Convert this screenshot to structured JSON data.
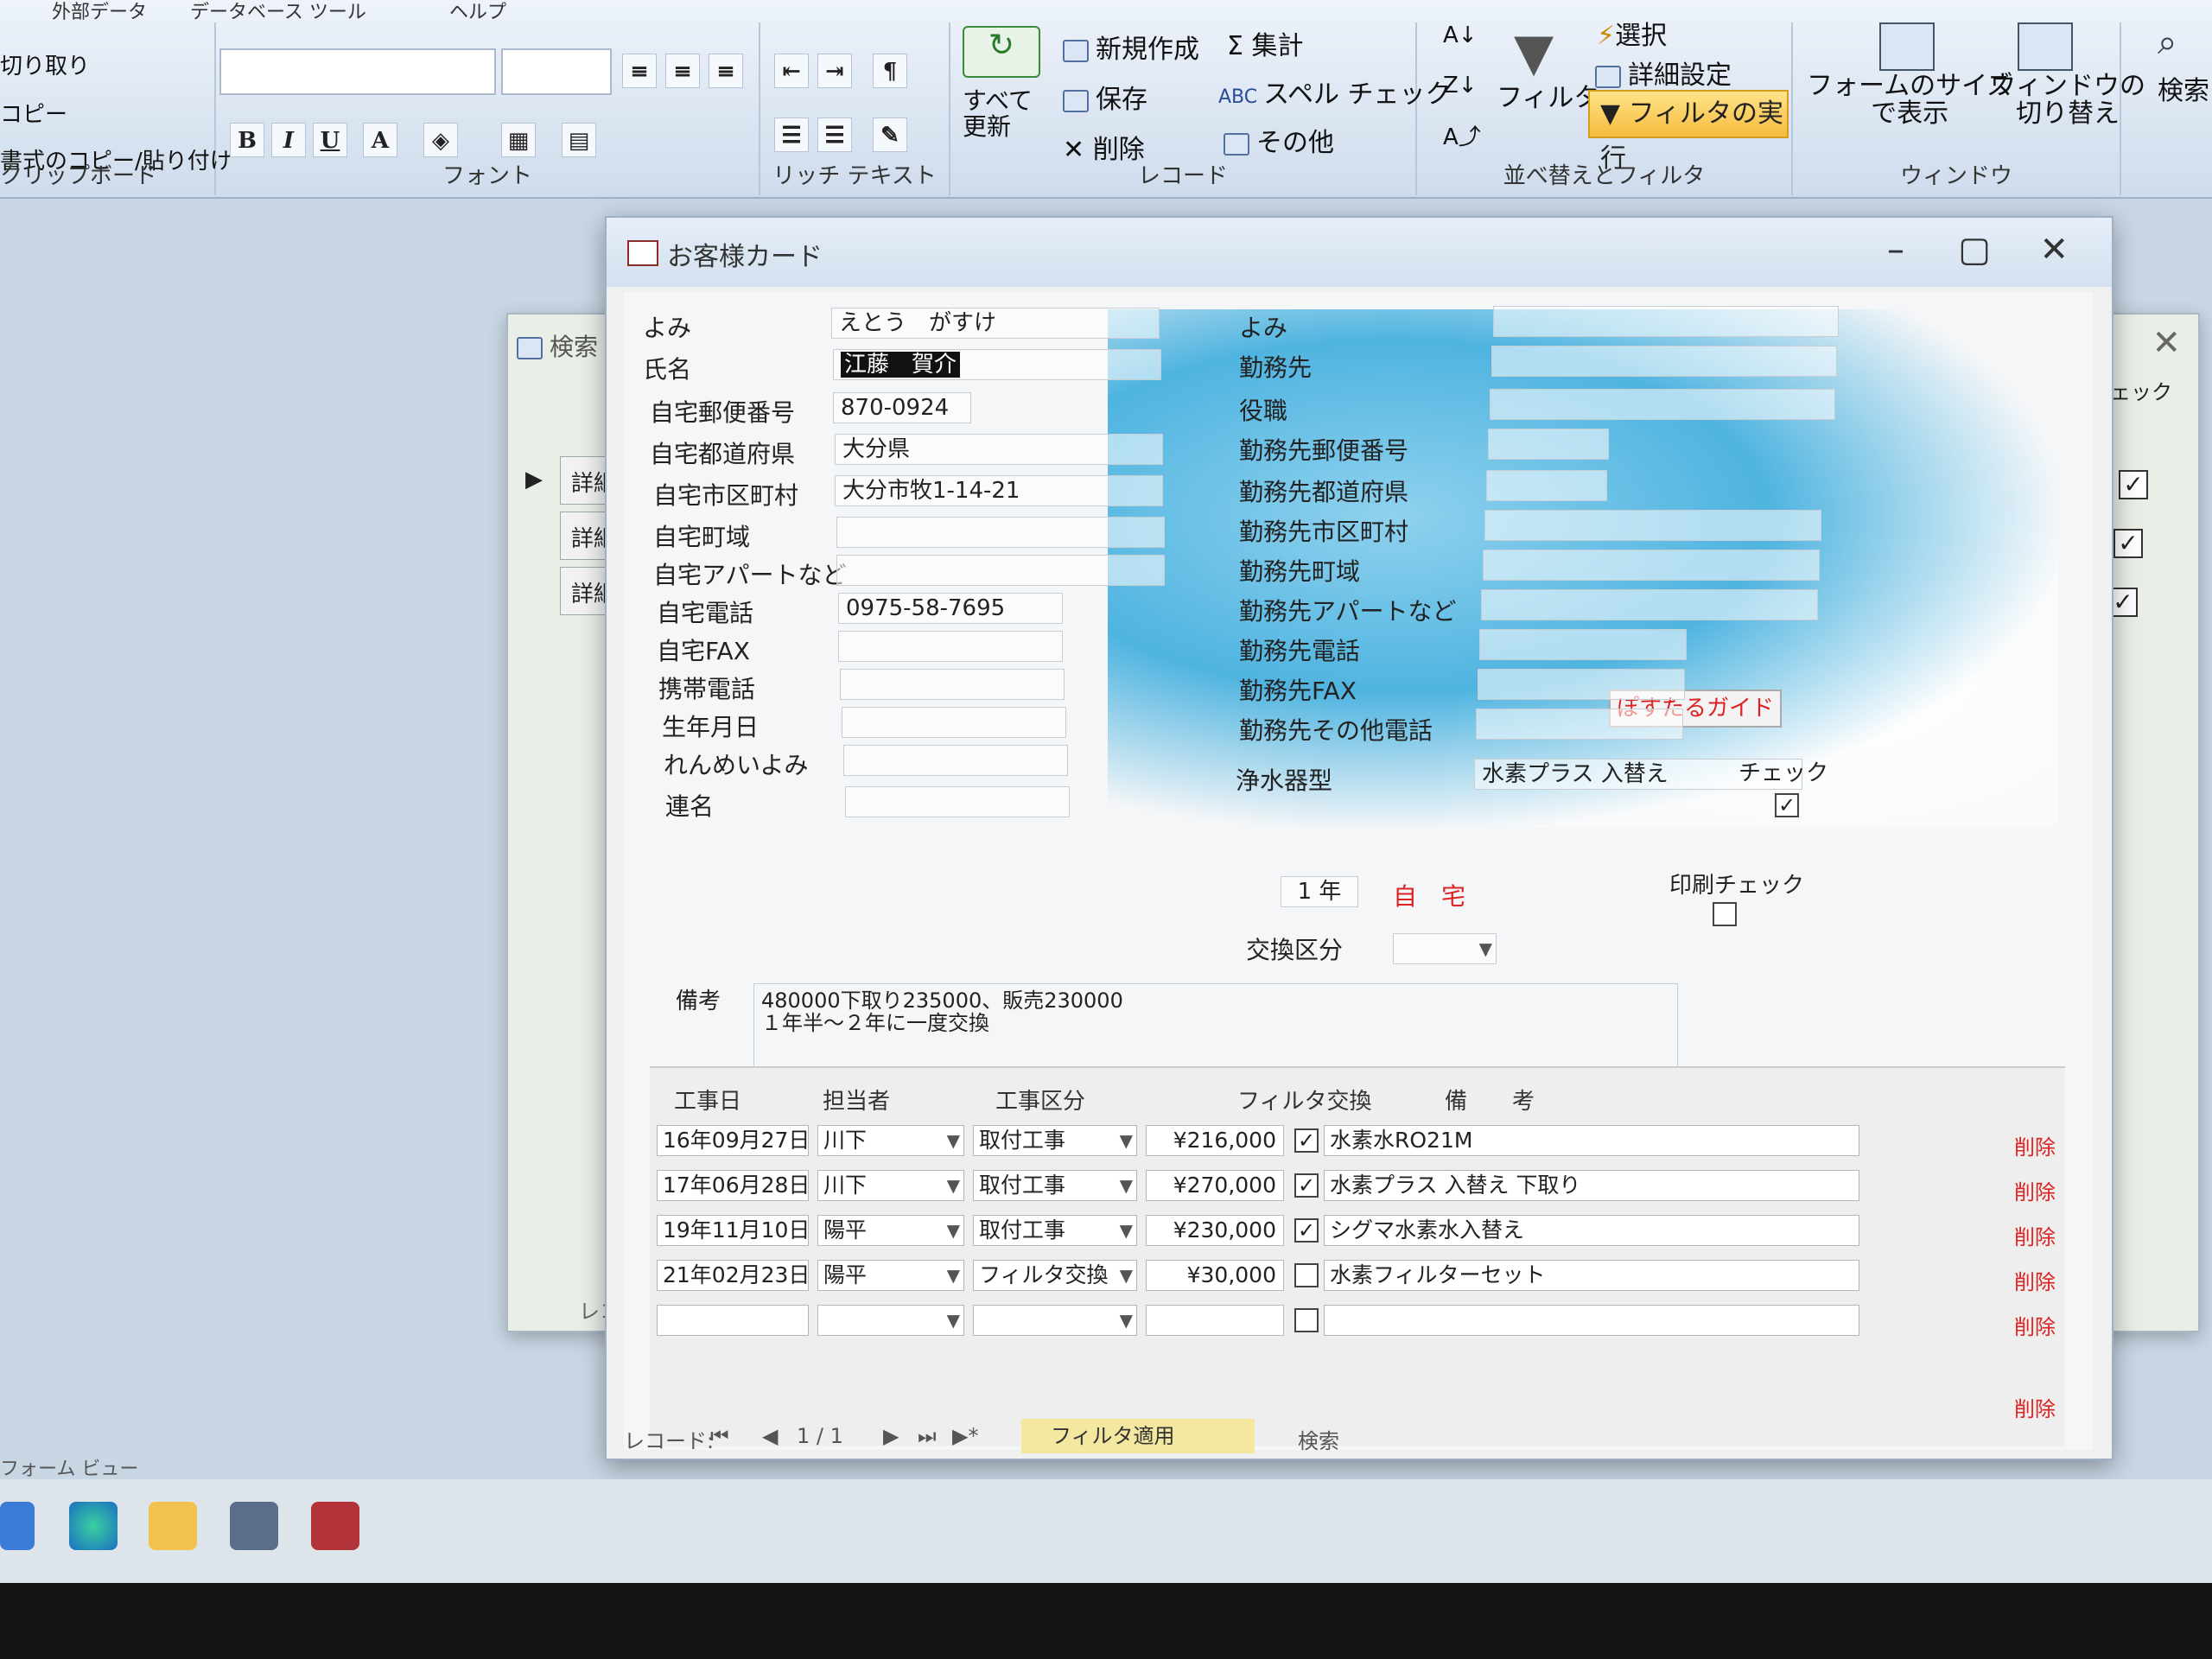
{
  "ribbon": {
    "tabs": [
      "外部データ",
      "データベース ツール",
      "ヘルプ"
    ],
    "clipboard": {
      "cut": "切り取り",
      "copy": "コピー",
      "format_painter": "書式のコピー/貼り付け",
      "label": "クリップボード"
    },
    "font": {
      "label": "フォント",
      "bold": "B",
      "italic": "I",
      "underline": "U",
      "font_color": "A"
    },
    "rich_text": {
      "label": "リッチ テキスト"
    },
    "records": {
      "refresh": "すべて\n更新",
      "new": "新規作成",
      "save": "保存",
      "delete": "削除",
      "totals": "集計",
      "spelling": "スペル チェック",
      "more": "その他",
      "label": "レコード"
    },
    "sort_filter": {
      "filter": "フィルタ",
      "selection": "選択",
      "advanced": "詳細設定",
      "toggle_filter": "フィルタの実行",
      "label": "並べ替えとフィルタ"
    },
    "window": {
      "size_to_fit": "フォームのサイズ\nで表示",
      "switch_windows": "ウィンドウの\n切り替え",
      "label": "ウィンドウ"
    },
    "find": {
      "label": "検索"
    }
  },
  "bg_window": {
    "title": "検索",
    "rows": [
      "詳細",
      "詳細",
      "詳細"
    ],
    "check_label": "チェック",
    "record_label": "レコード"
  },
  "window": {
    "title": "お客様カード"
  },
  "form": {
    "left": [
      {
        "label": "よみ",
        "value": "えとう　がすけ"
      },
      {
        "label": "氏名",
        "value": "江藤　賀介"
      },
      {
        "label": "自宅郵便番号",
        "value": "870-0924"
      },
      {
        "label": "自宅都道府県",
        "value": "大分県"
      },
      {
        "label": "自宅市区町村",
        "value": "大分市牧1-14-21"
      },
      {
        "label": "自宅町域",
        "value": ""
      },
      {
        "label": "自宅アパートなど",
        "value": ""
      },
      {
        "label": "自宅電話",
        "value": "0975-58-7695"
      },
      {
        "label": "自宅FAX",
        "value": ""
      },
      {
        "label": "携帯電話",
        "value": ""
      },
      {
        "label": "生年月日",
        "value": ""
      },
      {
        "label": "れんめいよみ",
        "value": ""
      },
      {
        "label": "連名",
        "value": ""
      }
    ],
    "guide_button": "ぽすたるガイド",
    "right": [
      {
        "label": "よみ",
        "value": ""
      },
      {
        "label": "勤務先",
        "value": ""
      },
      {
        "label": "役職",
        "value": ""
      },
      {
        "label": "勤務先郵便番号",
        "value": ""
      },
      {
        "label": "勤務先都道府県",
        "value": ""
      },
      {
        "label": "勤務先市区町村",
        "value": ""
      },
      {
        "label": "勤務先町域",
        "value": ""
      },
      {
        "label": "勤務先アパートなど",
        "value": ""
      },
      {
        "label": "勤務先電話",
        "value": ""
      },
      {
        "label": "勤務先FAX",
        "value": ""
      },
      {
        "label": "勤務先その他電話",
        "value": ""
      },
      {
        "label": "浄水器型",
        "value": "水素プラス 入替え"
      }
    ],
    "check_label": "チェック",
    "check_checked": true,
    "interval": "1 年",
    "home_label": "自　宅",
    "print_check_label": "印刷チェック",
    "exchange_label": "交換区分",
    "memo_label": "備考",
    "memo_value": "480000下取り235000、販売230000\n１年半～２年に一度交換"
  },
  "subform": {
    "headers": [
      "工事日",
      "担当者",
      "工事区分",
      "フィルタ交換",
      "備　　考"
    ],
    "rows": [
      {
        "date": "16年09月27日",
        "staff": "川下",
        "type": "取付工事",
        "amount": "¥216,000",
        "filter": true,
        "note": "水素水RO21M",
        "delete": "削除"
      },
      {
        "date": "17年06月28日",
        "staff": "川下",
        "type": "取付工事",
        "amount": "¥270,000",
        "filter": true,
        "note": "水素プラス 入替え 下取り",
        "delete": "削除"
      },
      {
        "date": "19年11月10日",
        "staff": "陽平",
        "type": "取付工事",
        "amount": "¥230,000",
        "filter": true,
        "note": "シグマ水素水入替え",
        "delete": "削除"
      },
      {
        "date": "21年02月23日",
        "staff": "陽平",
        "type": "フィルタ交換",
        "amount": "¥30,000",
        "filter": false,
        "note": "水素フィルターセット",
        "delete": "削除"
      },
      {
        "date": "",
        "staff": "",
        "type": "",
        "amount": "",
        "filter": false,
        "note": "",
        "delete": "削除"
      }
    ],
    "extra_delete": "削除"
  },
  "nav": {
    "record_label": "レコード:",
    "position": "1 / 1",
    "filter_applied": "フィルタ適用",
    "search": "検索"
  },
  "statusbar": {
    "text": "フォーム ビュー"
  },
  "colors": {
    "accent_red": "#dd2222",
    "filter_button": "#f5bb3c"
  }
}
